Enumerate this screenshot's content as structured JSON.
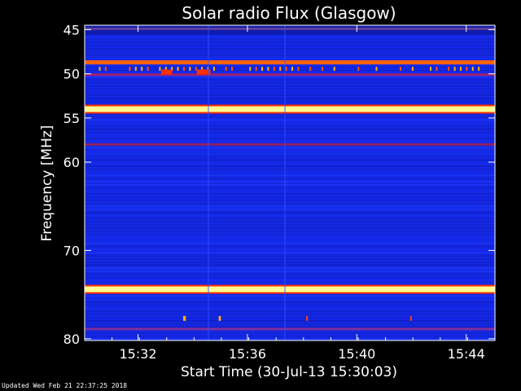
{
  "chart_data": {
    "type": "heatmap",
    "title": "Solar radio Flux (Glasgow)",
    "xlabel": "Start Time (30-Jul-13 15:30:03)",
    "ylabel": "Frequency [MHz]",
    "xlim_minutes": [
      0,
      15.0
    ],
    "ylim_mhz": [
      44.5,
      80.2
    ],
    "y_ticks": [
      {
        "value": 45,
        "label": "45"
      },
      {
        "value": 50,
        "label": "50"
      },
      {
        "value": 55,
        "label": "55"
      },
      {
        "value": 60,
        "label": "60"
      },
      {
        "value": 70,
        "label": "70"
      },
      {
        "value": 80,
        "label": "80"
      }
    ],
    "x_ticks": [
      {
        "minute": 1.95,
        "label": "15:32"
      },
      {
        "minute": 5.95,
        "label": "15:36"
      },
      {
        "minute": 9.95,
        "label": "15:40"
      },
      {
        "minute": 13.95,
        "label": "15:44"
      }
    ],
    "colormap": [
      "#000060",
      "#0a1ad0",
      "#2040ff",
      "#c00050",
      "#ff2000",
      "#ff9000",
      "#ffff80"
    ],
    "background_color": "#1428e6",
    "persistent_bands": [
      {
        "freq_mhz": 44.9,
        "intensity": "medium",
        "color": "#6040a0"
      },
      {
        "freq_mhz": 48.7,
        "intensity": "high",
        "color": "#ff6000"
      },
      {
        "freq_mhz": 50.1,
        "intensity": "medium",
        "color": "#a02070"
      },
      {
        "freq_mhz": 54.0,
        "intensity": "very high",
        "color": "#ffff90"
      },
      {
        "freq_mhz": 58.0,
        "intensity": "medium",
        "color": "#902060"
      },
      {
        "freq_mhz": 74.4,
        "intensity": "very high",
        "color": "#ffff90"
      },
      {
        "freq_mhz": 78.9,
        "intensity": "medium",
        "color": "#8030a0"
      }
    ],
    "bursts": [
      {
        "minute": 2.8,
        "freq_mhz": 49.8,
        "duration_min": 0.4,
        "color": "#ff3000"
      },
      {
        "minute": 4.1,
        "freq_mhz": 49.8,
        "duration_min": 0.5,
        "color": "#ff3000"
      },
      {
        "minute": 3.6,
        "freq_mhz": 77.7,
        "duration_min": 0.1,
        "color": "#ffb000"
      },
      {
        "minute": 4.9,
        "freq_mhz": 77.7,
        "duration_min": 0.08,
        "color": "#ffb000"
      },
      {
        "minute": 8.1,
        "freq_mhz": 77.7,
        "duration_min": 0.05,
        "color": "#ff4000"
      },
      {
        "minute": 11.9,
        "freq_mhz": 77.7,
        "duration_min": 0.04,
        "color": "#ff4000"
      }
    ]
  },
  "footer": {
    "updated_text": "Updated Wed Feb 21 22:37:25 2018"
  }
}
